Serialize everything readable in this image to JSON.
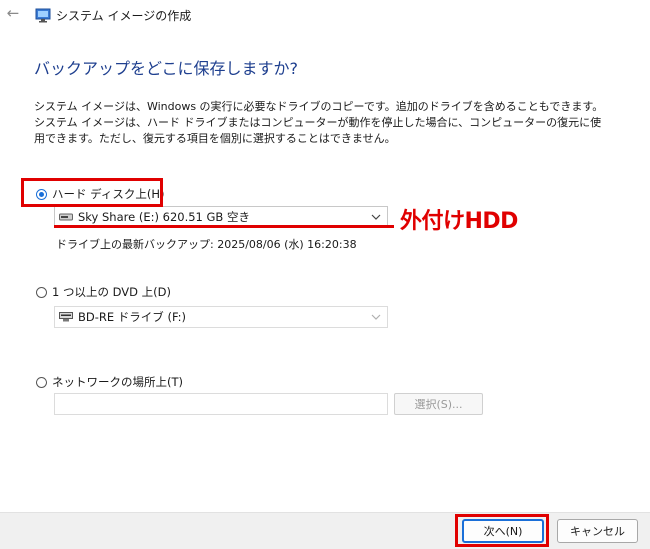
{
  "window": {
    "title": "システム イメージの作成"
  },
  "page": {
    "heading": "バックアップをどこに保存しますか?",
    "description": "システム イメージは、Windows の実行に必要なドライブのコピーです。追加のドライブを含めることもできます。システム イメージは、ハード ドライブまたはコンピューターが動作を停止した場合に、コンピューターの復元に使用できます。ただし、復元する項目を個別に選択することはできません。"
  },
  "options": {
    "hard_disk": {
      "label": "ハード ディスク上(H)",
      "selected": true,
      "drive_value": "Sky Share (E:)  620.51 GB 空き",
      "last_backup": "ドライブ上の最新バックアップ:  2025/08/06 (水) 16:20:38"
    },
    "dvd": {
      "label": "1 つ以上の DVD 上(D)",
      "selected": false,
      "drive_value": "BD-RE ドライブ (F:)"
    },
    "network": {
      "label": "ネットワークの場所上(T)",
      "selected": false,
      "path_value": "",
      "browse_label": "選択(S)..."
    }
  },
  "annotation": {
    "label": "外付けHDD",
    "color": "#e00000"
  },
  "footer": {
    "next_label": "次へ(N)",
    "cancel_label": "キャンセル"
  },
  "colors": {
    "heading": "#1e3f8f",
    "accent": "#1a6fd8"
  }
}
